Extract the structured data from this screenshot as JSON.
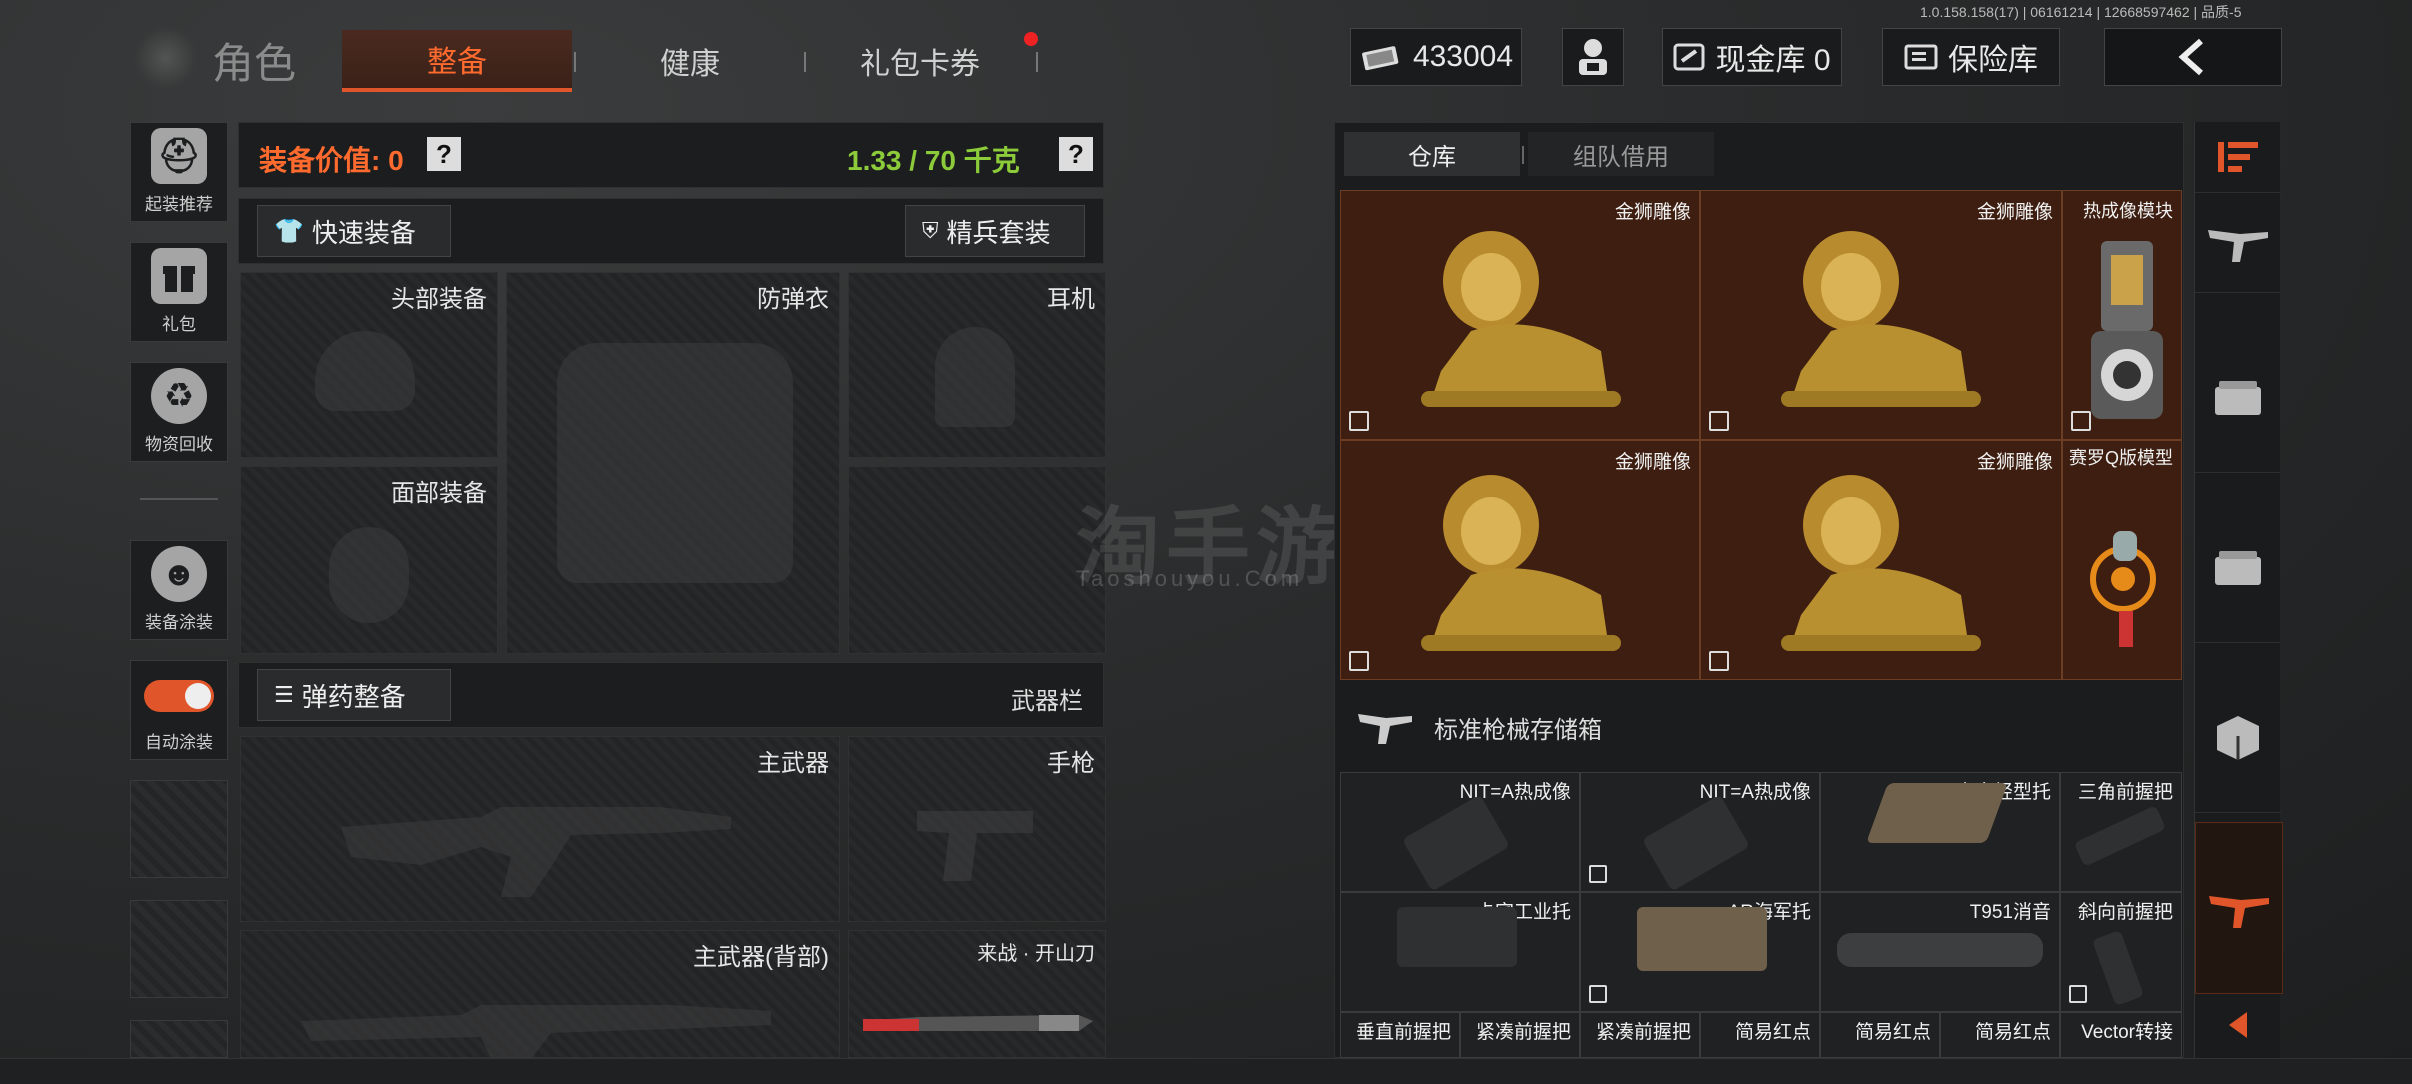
{
  "version": "1.0.158.158(17) | 06161214 | 12668597462 | 品质-5",
  "header": {
    "title": "角色",
    "tabs": [
      {
        "label": "整备",
        "active": true
      },
      {
        "label": "健康",
        "active": false
      },
      {
        "label": "礼包卡券",
        "active": false,
        "badge": true
      }
    ],
    "currency_value": "433004",
    "cash_vault_label": "现金库 0",
    "insurance_vault_label": "保险库"
  },
  "sidebar": [
    {
      "label": "起装推荐",
      "icon": "helmet-gear-icon"
    },
    {
      "label": "礼包",
      "icon": "gift-icon"
    },
    {
      "label": "物资回收",
      "icon": "recycle-icon"
    },
    {
      "label": "装备涂装",
      "icon": "soldier-icon"
    },
    {
      "label": "自动涂装",
      "icon": "toggle-icon"
    }
  ],
  "loadout": {
    "equip_value_label": "装备价值: 0",
    "weight_label": "1.33 / 70 千克",
    "quick_equip": "快速装备",
    "elite_set": "精兵套装",
    "slots": {
      "head": "头部装备",
      "vest": "防弹衣",
      "headset": "耳机",
      "face": "面部装备"
    },
    "ammo_button": "弹药整备",
    "weapon_bar": "武器栏",
    "weapons": {
      "primary": "主武器",
      "pistol": "手枪",
      "primary_back": "主武器(背部)",
      "melee": "来战 · 开山刀"
    }
  },
  "warehouse": {
    "tabs": [
      {
        "label": "仓库",
        "active": true
      },
      {
        "label": "组队借用",
        "active": false
      }
    ],
    "featured_items": [
      {
        "name": "金狮雕像"
      },
      {
        "name": "金狮雕像"
      },
      {
        "name": "热成像模块"
      },
      {
        "name": "金狮雕像"
      },
      {
        "name": "金狮雕像"
      },
      {
        "name": "赛罗Q版模型"
      }
    ],
    "storage_box_label": "标准枪械存储箱",
    "grid_items": [
      {
        "name": "NIT=A热成像"
      },
      {
        "name": "NIT=A热成像"
      },
      {
        "name": "卡宾轻型托"
      },
      {
        "name": "三角前握把"
      },
      {
        "name": "卡宾工业托"
      },
      {
        "name": "AR海军托"
      },
      {
        "name": "T951消音"
      },
      {
        "name": "斜向前握把"
      },
      {
        "name": "垂直前握把"
      },
      {
        "name": "紧凑前握把"
      },
      {
        "name": "紧凑前握把"
      },
      {
        "name": "简易红点"
      },
      {
        "name": "简易红点"
      },
      {
        "name": "简易红点"
      },
      {
        "name": "Vector转接"
      }
    ]
  },
  "colors": {
    "accent": "#e0562a",
    "weight_green": "#8ccc3a",
    "cell_brown": "#3d1e10",
    "gold": "#c9a24a"
  }
}
